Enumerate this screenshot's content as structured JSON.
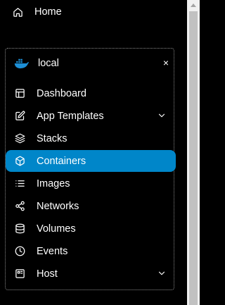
{
  "home": {
    "label": "Home",
    "icon": "home-icon"
  },
  "environment": {
    "name": "local",
    "icon": "docker-whale-icon",
    "close_glyph": "×"
  },
  "nav": {
    "items": [
      {
        "label": "Dashboard",
        "icon": "dashboard-icon"
      },
      {
        "label": "App Templates",
        "icon": "edit-icon",
        "expandable": true
      },
      {
        "label": "Stacks",
        "icon": "layers-icon"
      },
      {
        "label": "Containers",
        "icon": "box-icon",
        "active": true
      },
      {
        "label": "Images",
        "icon": "list-icon"
      },
      {
        "label": "Networks",
        "icon": "share-icon"
      },
      {
        "label": "Volumes",
        "icon": "database-icon"
      },
      {
        "label": "Events",
        "icon": "clock-icon"
      },
      {
        "label": "Host",
        "icon": "server-icon",
        "expandable": true
      }
    ]
  },
  "colors": {
    "background": "#000000",
    "active": "#0086c9",
    "docker_blue": "#1d8fd6",
    "border": "#8a8a8a",
    "scroll_track": "#f0f0f0",
    "scroll_thumb": "#c1c1c1"
  }
}
